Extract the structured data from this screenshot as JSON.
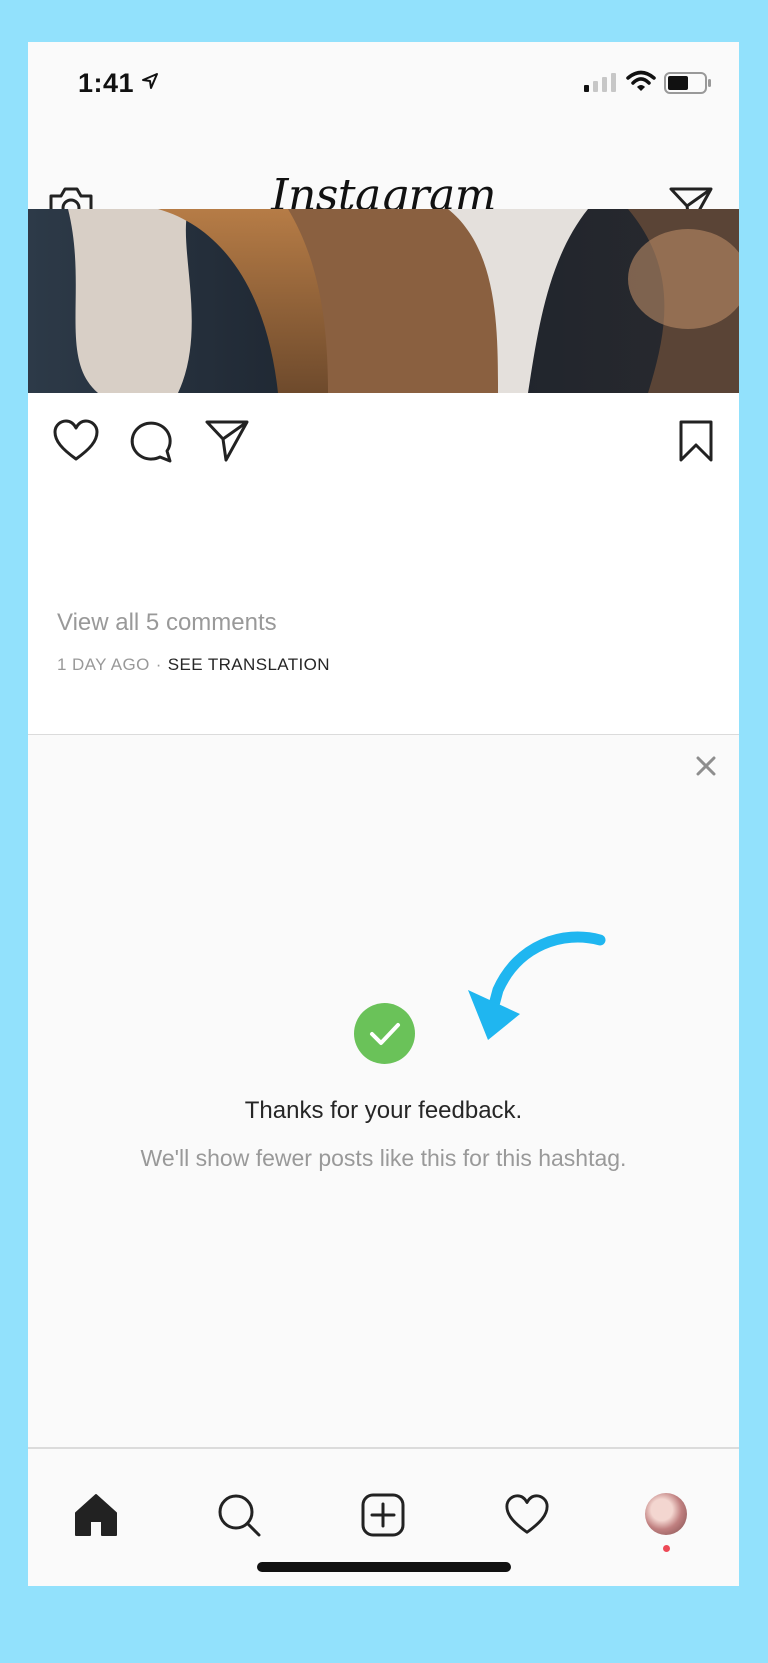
{
  "status_bar": {
    "time": "1:41"
  },
  "header": {
    "logo": "Instagram"
  },
  "post": {
    "view_comments": "View all 5 comments",
    "timestamp": "1 DAY AGO",
    "separator": "·",
    "see_translation": "SEE TRANSLATION"
  },
  "feedback": {
    "title": "Thanks for your feedback.",
    "subtitle": "We'll show fewer posts like this for this hashtag."
  },
  "colors": {
    "background": "#92e1fc",
    "check_green": "#6ac259",
    "arrow_blue": "#1fb6f0",
    "notification_red": "#ed4956"
  },
  "icons": [
    "location-arrow-icon",
    "signal-icon",
    "wifi-icon",
    "battery-icon",
    "camera-icon",
    "direct-message-icon",
    "heart-icon",
    "comment-icon",
    "share-icon",
    "bookmark-icon",
    "close-icon",
    "checkmark-icon",
    "home-icon",
    "search-icon",
    "add-post-icon",
    "activity-heart-icon"
  ]
}
